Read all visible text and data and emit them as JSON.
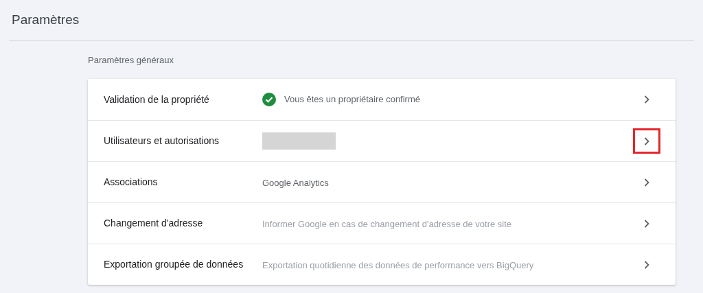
{
  "page": {
    "title": "Paramètres"
  },
  "section": {
    "title": "Paramètres généraux"
  },
  "rows": [
    {
      "label": "Validation de la propriété",
      "kind": "status",
      "value": "Vous êtes un propriétaire confirmé",
      "highlighted": false
    },
    {
      "label": "Utilisateurs et autorisations",
      "kind": "redacted",
      "highlighted": true
    },
    {
      "label": "Associations",
      "kind": "text",
      "value": "Google Analytics",
      "highlighted": false
    },
    {
      "label": "Changement d'adresse",
      "kind": "hint",
      "value": "Informer Google en cas de changement d'adresse de votre site",
      "highlighted": false
    },
    {
      "label": "Exportation groupée de données",
      "kind": "hint",
      "value": "Exportation quotidienne des données de performance vers BigQuery",
      "highlighted": false
    }
  ]
}
